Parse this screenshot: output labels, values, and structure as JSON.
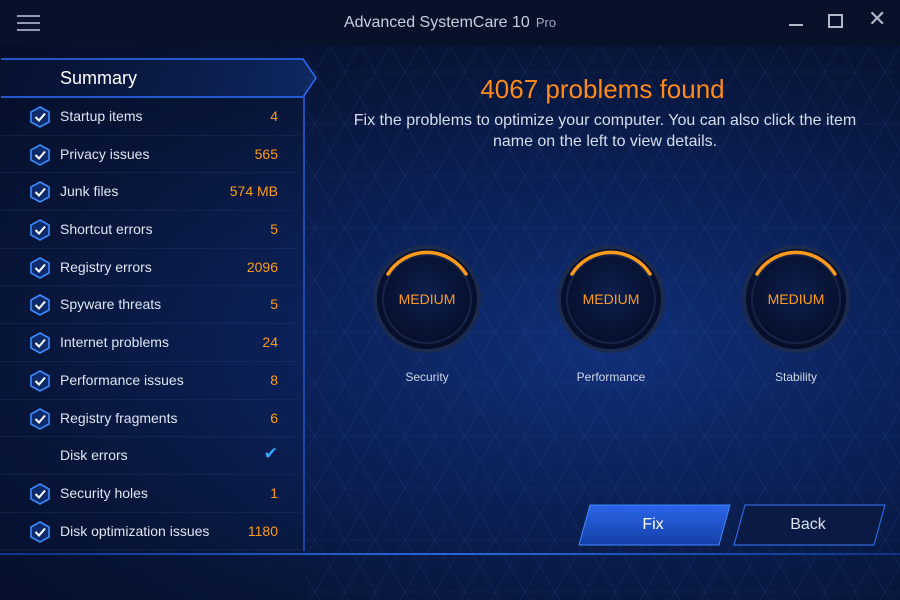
{
  "window": {
    "title": "Advanced SystemCare 10",
    "edition": "Pro",
    "menu_icon": "hamburger-menu-icon",
    "controls": [
      "minimize-icon",
      "maximize-icon",
      "close-icon"
    ],
    "close_glyph": "✕"
  },
  "sidebar": {
    "summary_label": "Summary",
    "items": [
      {
        "label": "Startup items",
        "value": "4",
        "icon": "shield-check-icon"
      },
      {
        "label": "Privacy issues",
        "value": "565",
        "icon": "shield-check-icon"
      },
      {
        "label": "Junk files",
        "value": "574 MB",
        "icon": "shield-check-icon"
      },
      {
        "label": "Shortcut errors",
        "value": "5",
        "icon": "shield-check-icon"
      },
      {
        "label": "Registry errors",
        "value": "2096",
        "icon": "shield-check-icon"
      },
      {
        "label": "Spyware threats",
        "value": "5",
        "icon": "shield-check-icon"
      },
      {
        "label": "Internet problems",
        "value": "24",
        "icon": "shield-check-icon"
      },
      {
        "label": "Performance issues",
        "value": "8",
        "icon": "shield-check-icon"
      },
      {
        "label": "Registry fragments",
        "value": "6",
        "icon": "shield-check-icon"
      },
      {
        "label": "Disk errors",
        "value": "✔",
        "icon": "checkmark-icon"
      },
      {
        "label": "Security holes",
        "value": "1",
        "icon": "shield-check-icon"
      },
      {
        "label": "Disk optimization issues",
        "value": "1180",
        "icon": "shield-check-icon"
      }
    ]
  },
  "content": {
    "headline": "4067 problems found",
    "description": "Fix the problems to optimize your computer. You can also click the item name on the left to view details.",
    "gauges": [
      {
        "status": "MEDIUM",
        "label": "Security"
      },
      {
        "status": "MEDIUM",
        "label": "Performance"
      },
      {
        "status": "MEDIUM",
        "label": "Stability"
      }
    ]
  },
  "actions": {
    "fix_label": "Fix",
    "back_label": "Back"
  },
  "colors": {
    "accent_orange": "#ff8a1a",
    "check_blue": "#38a7ff",
    "button_blue": "#1f57d6",
    "background": "#06102a"
  }
}
